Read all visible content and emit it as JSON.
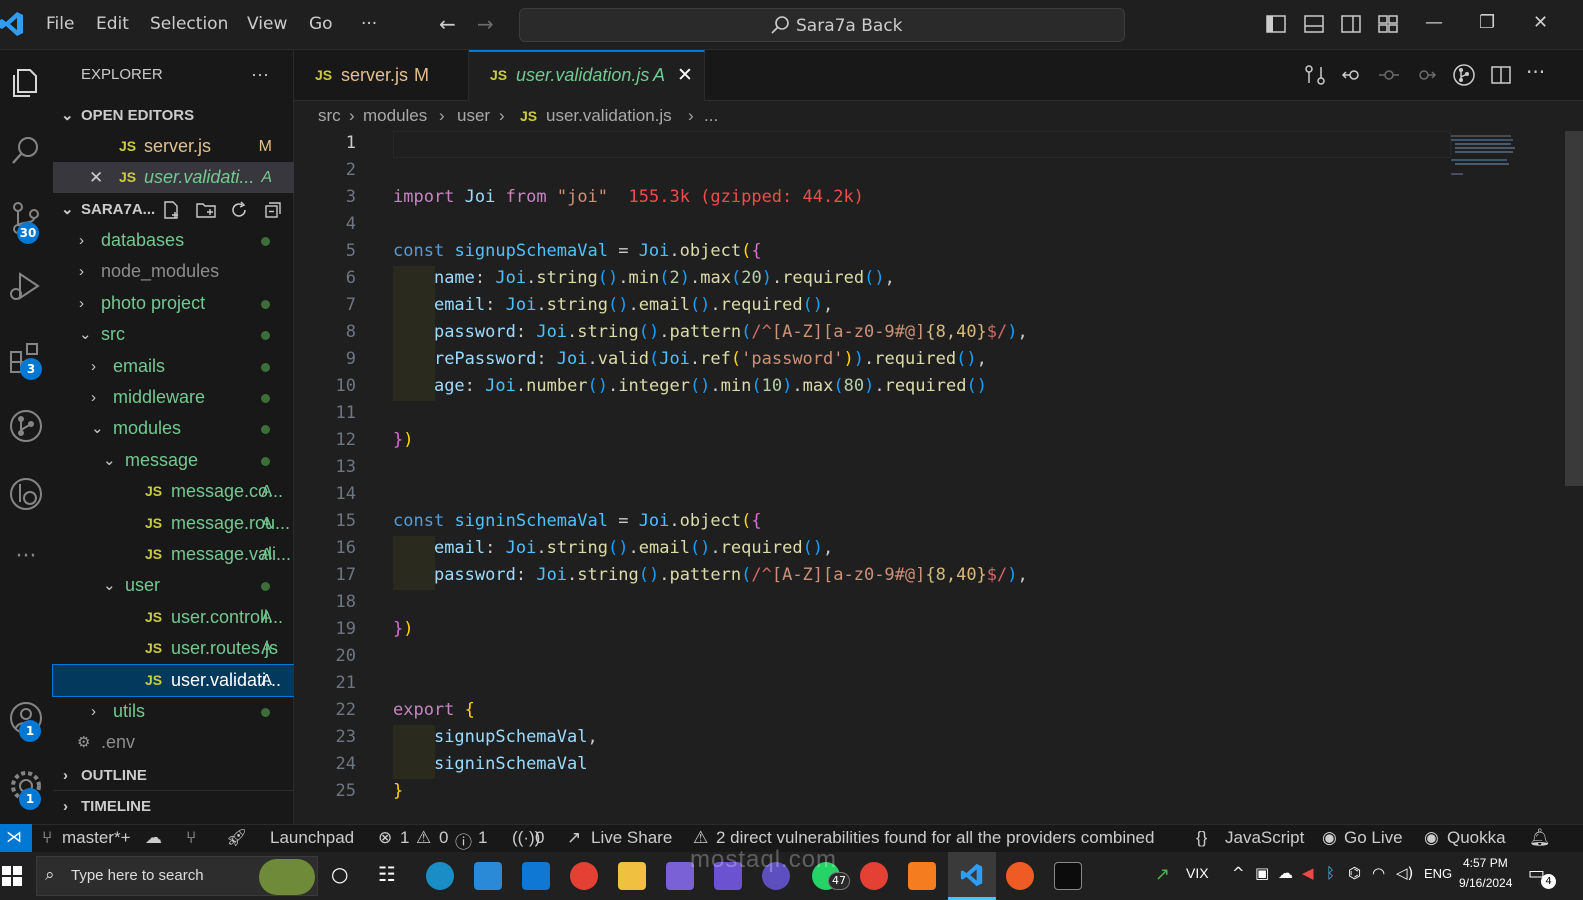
{
  "titlebar": {
    "menu": [
      "File",
      "Edit",
      "Selection",
      "View",
      "Go",
      "···"
    ],
    "command_center": "Sara7a Back",
    "window_controls": {
      "minimize": "—",
      "restore": "❐",
      "close": "✕"
    }
  },
  "activity": {
    "badges": {
      "source_control": "30",
      "extensions": "3",
      "accounts": "1",
      "settings": "1"
    }
  },
  "sidebar": {
    "title": "EXPLORER",
    "more": "···",
    "open_editors_title": "OPEN EDITORS",
    "open_editors": [
      {
        "name": "server.js",
        "status": "M"
      },
      {
        "name": "user.validati...",
        "status": "A"
      }
    ],
    "project_title": "SARA7A...",
    "tree": [
      {
        "label": "databases",
        "icon": "›",
        "dot": true
      },
      {
        "label": "node_modules",
        "icon": "›",
        "dot": false
      },
      {
        "label": "photo project",
        "icon": "›",
        "dot": true
      },
      {
        "label": "src",
        "icon": "⌄",
        "dot": true
      },
      {
        "label": "emails",
        "icon": "›",
        "dot": true
      },
      {
        "label": "middleware",
        "icon": "›",
        "dot": true
      },
      {
        "label": "modules",
        "icon": "⌄",
        "dot": true
      },
      {
        "label": "message",
        "icon": "⌄",
        "dot": true
      },
      {
        "label": "message.co...",
        "icon": "JS",
        "status": "A"
      },
      {
        "label": "message.rou...",
        "icon": "JS",
        "status": "A"
      },
      {
        "label": "message.vali...",
        "icon": "JS",
        "status": "A"
      },
      {
        "label": "user",
        "icon": "⌄",
        "dot": true
      },
      {
        "label": "user.controll...",
        "icon": "JS",
        "status": "A"
      },
      {
        "label": "user.routes.js",
        "icon": "JS",
        "status": "A"
      },
      {
        "label": "user.validati...",
        "icon": "JS",
        "status": "A"
      },
      {
        "label": "utils",
        "icon": "›",
        "dot": true
      },
      {
        "label": ".env",
        "icon": "⚙"
      }
    ],
    "outline": "OUTLINE",
    "timeline": "TIMELINE"
  },
  "tabs": [
    {
      "label": "server.js",
      "status": "M",
      "icon": "JS"
    },
    {
      "label": "user.validation.js",
      "status": "A",
      "icon": "JS",
      "active": true
    }
  ],
  "breadcrumbs": [
    "src",
    "modules",
    "user",
    "user.validation.js",
    "..."
  ],
  "editor": {
    "lines": [
      "1",
      "2",
      "3",
      "4",
      "5",
      "6",
      "7",
      "8",
      "9",
      "10",
      "11",
      "12",
      "13",
      "14",
      "15",
      "16",
      "17",
      "18",
      "19",
      "20",
      "21",
      "22",
      "23",
      "24",
      "25"
    ],
    "import_size": "155.3k (gzipped: 44.2k)"
  },
  "statusbar": {
    "branch": "master*+",
    "launchpad": "Launchpad",
    "errors": "1",
    "warnings": "0",
    "infos": "1",
    "ports": "0",
    "live_share": "Live Share",
    "vulnerabilities": "2 direct vulnerabilities found for all the providers combined",
    "language": "JavaScript",
    "go_live": "Go Live",
    "quokka": "Quokka"
  },
  "taskbar": {
    "search_placeholder": "Type here to search",
    "whatsapp_badge": "47",
    "stock": "VIX",
    "lang": "ENG",
    "time": "4:57 PM",
    "date": "9/16/2024",
    "notif_badge": "4",
    "watermark": "mostaql.com"
  },
  "colors": {
    "accent": "#0078d4",
    "keyword": "#569cd6",
    "variable": "#9cdcfe",
    "function": "#dcdcaa",
    "string": "#ce9178",
    "number": "#b5cea8",
    "regex": "#d16969",
    "git_added": "#73c991",
    "git_modified": "#e2c08d"
  }
}
